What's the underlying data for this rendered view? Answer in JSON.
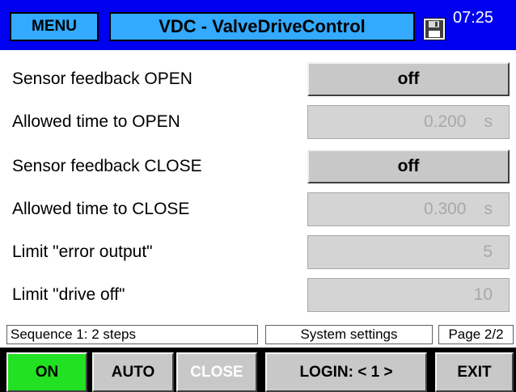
{
  "header": {
    "menu_label": "MENU",
    "title": "VDC - ValveDriveControl",
    "time": "07:25",
    "save_icon": "floppy-disk-icon",
    "colors": {
      "bar": "#0000f0",
      "button": "#33aaff"
    }
  },
  "rows": [
    {
      "label": "Sensor feedback OPEN",
      "kind": "toggle",
      "value": "off"
    },
    {
      "label": "Allowed time to OPEN",
      "kind": "field",
      "value": "0.200",
      "unit": "s"
    },
    {
      "label": "Sensor feedback CLOSE",
      "kind": "toggle",
      "value": "off"
    },
    {
      "label": "Allowed time to CLOSE",
      "kind": "field",
      "value": "0.300",
      "unit": "s"
    },
    {
      "label": "Limit \"error output\"",
      "kind": "field",
      "value": "5",
      "unit": ""
    },
    {
      "label": "Limit \"drive off\"",
      "kind": "field",
      "value": "10",
      "unit": ""
    }
  ],
  "status": {
    "sequence": "Sequence 1: 2 steps",
    "section": "System settings",
    "page": "Page 2/2"
  },
  "footer": {
    "on_label": "ON",
    "auto_label": "AUTO",
    "close_label": "CLOSE",
    "login_label": "LOGIN: < 1 >",
    "exit_label": "EXIT",
    "colors": {
      "on_active": "#22e022",
      "disabled_text": "#ffffff"
    }
  }
}
